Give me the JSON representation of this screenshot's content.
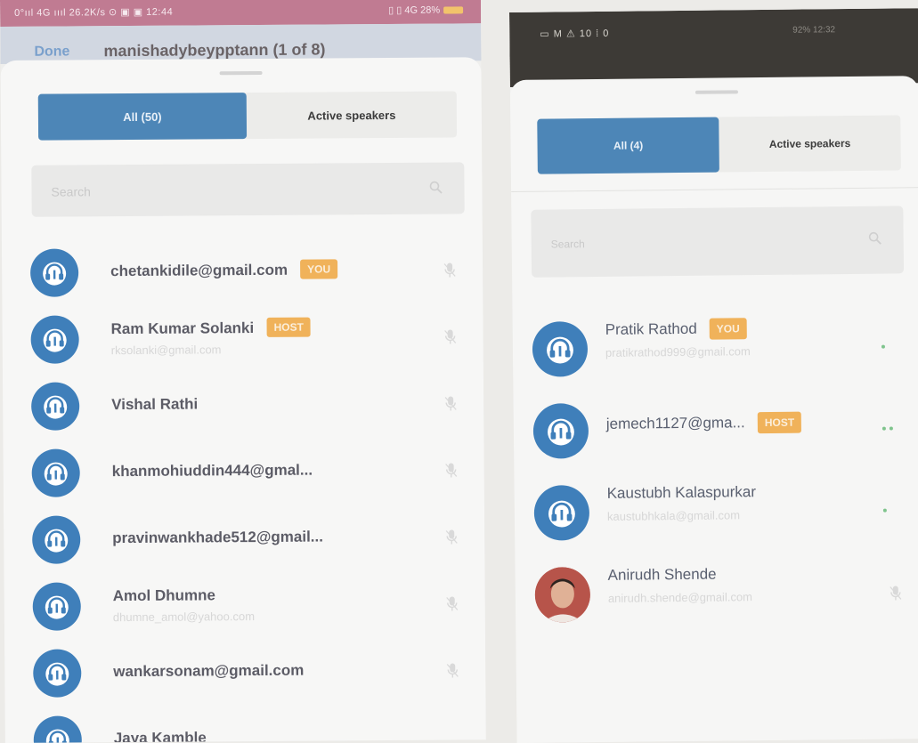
{
  "left_screen": {
    "status_bar": {
      "left": "0°ııl 4G ıııl 26.2K/s ⊙ ▣ ▣ 12:44",
      "right": "▯ ▯ 4G 28%"
    },
    "header": {
      "done_label": "Done",
      "title": "manishadybeypptann (1 of 8)"
    },
    "tabs": {
      "all": "All (50)",
      "active": "Active speakers"
    },
    "search": {
      "placeholder": "Search"
    },
    "participants": [
      {
        "name": "chetankidile@gmail.com",
        "email": "",
        "badge": "YOU"
      },
      {
        "name": "Ram Kumar Solanki",
        "email": "rksolanki@gmail.com",
        "badge": "HOST"
      },
      {
        "name": "Vishal Rathi",
        "email": "",
        "badge": ""
      },
      {
        "name": "khanmohiuddin444@gmal...",
        "email": "",
        "badge": ""
      },
      {
        "name": "pravinwankhade512@gmail...",
        "email": "",
        "badge": ""
      },
      {
        "name": "Amol Dhumne",
        "email": "dhumne_amol@yahoo.com",
        "badge": ""
      },
      {
        "name": "wankarsonam@gmail.com",
        "email": "",
        "badge": ""
      },
      {
        "name": "Jaya Kamble",
        "email": "",
        "badge": ""
      }
    ]
  },
  "right_screen": {
    "status_bar": {
      "left": "▭ M ⚠ 10 ⁞ 0",
      "right": "92% 12:32"
    },
    "tabs": {
      "all": "All (4)",
      "active": "Active speakers"
    },
    "search": {
      "placeholder": "Search"
    },
    "participants": [
      {
        "name": "Pratik Rathod",
        "email": "pratikrathod999@gmail.com",
        "badge": "YOU",
        "avatar": "headset-icon",
        "status": "dot"
      },
      {
        "name": "jemech1127@gma...",
        "email": "",
        "badge": "HOST",
        "avatar": "headset-icon",
        "status": "dots"
      },
      {
        "name": "Kaustubh Kalaspurkar",
        "email": "kaustubhkala@gmail.com",
        "badge": "",
        "avatar": "headset-icon",
        "status": "dot"
      },
      {
        "name": "Anirudh Shende",
        "email": "anirudh.shende@gmail.com",
        "badge": "",
        "avatar": "photo",
        "status": "mic"
      }
    ]
  },
  "colors": {
    "accent": "#4d86b7",
    "badge": "#f0b25a",
    "avatar": "#3f7fba"
  }
}
